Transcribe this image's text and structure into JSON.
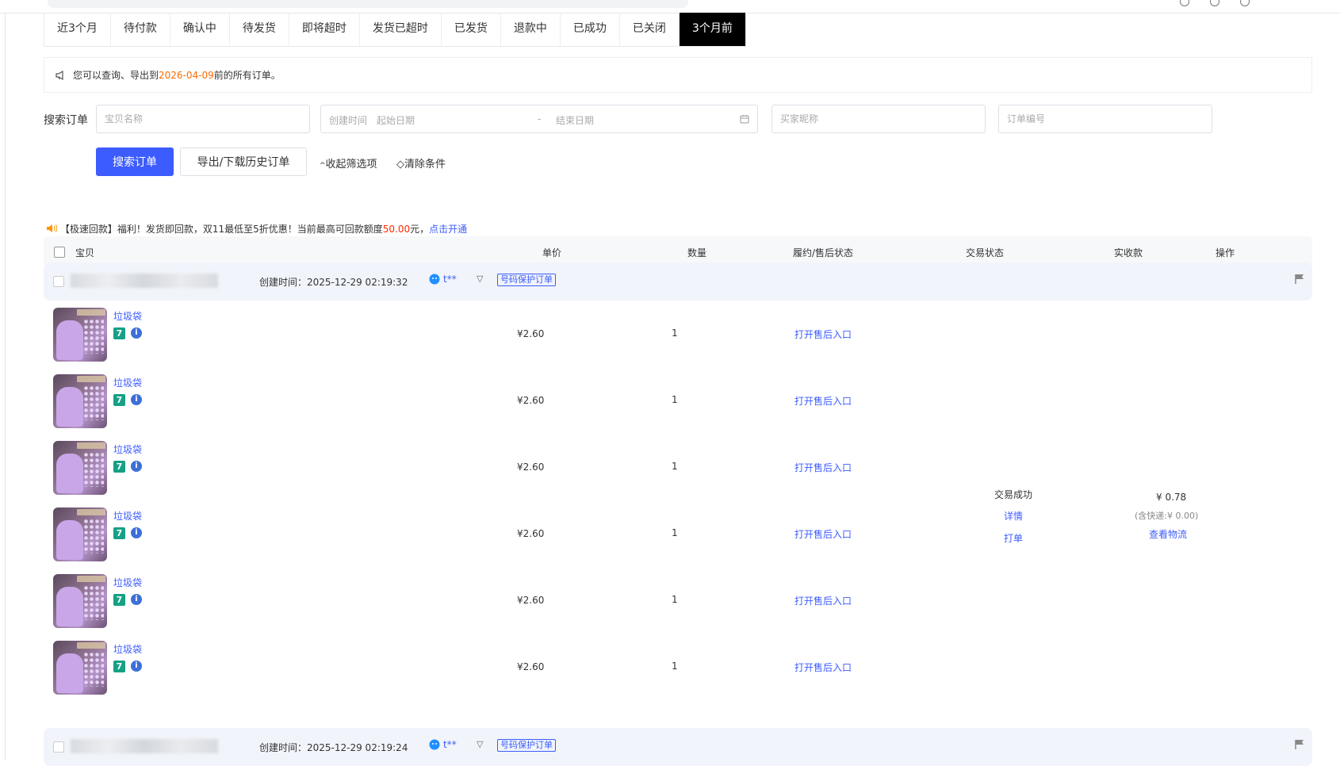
{
  "tabs": [
    {
      "label": "近3个月",
      "active": false
    },
    {
      "label": "待付款",
      "active": false
    },
    {
      "label": "确认中",
      "active": false
    },
    {
      "label": "待发货",
      "active": false
    },
    {
      "label": "即将超时",
      "active": false
    },
    {
      "label": "发货已超时",
      "active": false
    },
    {
      "label": "已发货",
      "active": false
    },
    {
      "label": "退款中",
      "active": false
    },
    {
      "label": "已成功",
      "active": false
    },
    {
      "label": "已关闭",
      "active": false
    },
    {
      "label": "3个月前",
      "active": true
    }
  ],
  "notice": {
    "prefix": "您可以查询、导出到 ",
    "date": "2026-04-09",
    "suffix": " 前的所有订单。"
  },
  "search": {
    "label": "搜索订单",
    "item_placeholder": "宝贝名称",
    "date_label": "创建时间",
    "start_placeholder": "起始日期",
    "sep": "-",
    "end_placeholder": "结束日期",
    "buyer_placeholder": "买家昵称",
    "order_placeholder": "订单编号",
    "search_btn": "搜索订单",
    "export_btn": "导出/下载历史订单",
    "collapse": "收起筛选项",
    "clear": "清除条件"
  },
  "promo": {
    "text": "【极速回款】福利！发货即回款，双11最低至5折优惠！当前最高可回款额度",
    "amount": "50.00",
    "unit": "元，",
    "link": "点击开通"
  },
  "table_headers": {
    "item": "宝贝",
    "price": "单价",
    "qty": "数量",
    "after": "履约/售后状态",
    "trade": "交易状态",
    "paid": "实收款",
    "ops": "操作"
  },
  "orders": [
    {
      "created": "创建时间：2025-12-29 02:19:32",
      "buyer": "t**",
      "tag": "号码保护订单",
      "items": [
        {
          "name": "垃圾袋",
          "badge": "7",
          "price": "¥2.60",
          "qty": "1",
          "after": "打开售后入口"
        },
        {
          "name": "垃圾袋",
          "badge": "7",
          "price": "¥2.60",
          "qty": "1",
          "after": "打开售后入口"
        },
        {
          "name": "垃圾袋",
          "badge": "7",
          "price": "¥2.60",
          "qty": "1",
          "after": "打开售后入口"
        },
        {
          "name": "垃圾袋",
          "badge": "7",
          "price": "¥2.60",
          "qty": "1",
          "after": "打开售后入口"
        },
        {
          "name": "垃圾袋",
          "badge": "7",
          "price": "¥2.60",
          "qty": "1",
          "after": "打开售后入口"
        },
        {
          "name": "垃圾袋",
          "badge": "7",
          "price": "¥2.60",
          "qty": "1",
          "after": "打开售后入口"
        }
      ],
      "trade_status": "交易成功",
      "detail": "详情",
      "print": "打单",
      "paid": "¥ 0.78",
      "shipping": "(含快递:¥ 0.00)",
      "logistics": "查看物流"
    },
    {
      "created": "创建时间：2025-12-29 02:19:24",
      "buyer": "t**",
      "tag": "号码保护订单"
    }
  ],
  "colors": {
    "primary": "#3d5cff",
    "highlight": "#ff6a00",
    "red": "#ff2a00",
    "active_tab": "#000000"
  }
}
